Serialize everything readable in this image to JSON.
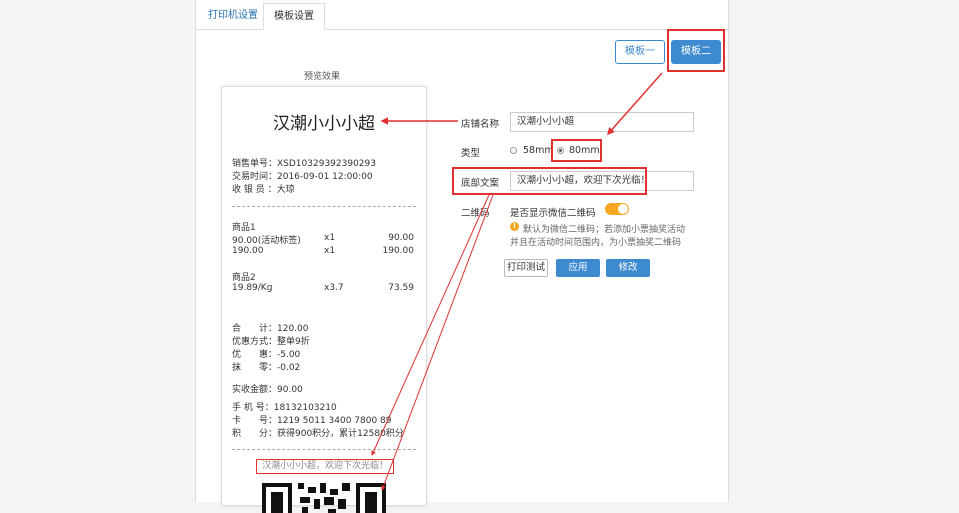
{
  "tabs": [
    {
      "label": "打印机设置"
    },
    {
      "label": "模板设置"
    }
  ],
  "template_buttons": {
    "t1": "模板一",
    "t2": "模板二"
  },
  "preview": {
    "title": "预览效果",
    "shop_name": "汉潮小小小超",
    "order_no": "销售单号：XSD10329392390293",
    "trade_time": "交易时间：2016-09-01 12:00:00",
    "cashier": "收 银 员 ：大琼",
    "items": [
      {
        "name": "商品1",
        "lines": [
          {
            "a": "90.00(活动标签)",
            "b": "x1",
            "c": "90.00"
          },
          {
            "a": "190.00",
            "b": "x1",
            "c": "190.00"
          }
        ]
      },
      {
        "name": "商品2",
        "lines": [
          {
            "a": "19.89/Kg",
            "b": "x3.7",
            "c": "73.59"
          }
        ]
      }
    ],
    "total": "合　　计：120.00",
    "discount_method": "优惠方式：整单9折",
    "discount": "优　　惠：-5.00",
    "round_off": "抹　　零：-0.02",
    "received": "实收金额：90.00",
    "phone": "手 机 号：18132103210",
    "card": "卡　　号：1219 5011 3400 7800 89",
    "points": "积　　分：获得900积分，累计12580积分",
    "footer": "汉潮小小小超，欢迎下次光临！"
  },
  "form": {
    "shop_label": "店铺名称",
    "shop_value": "汉潮小小小超",
    "type_label": "类型",
    "type_58": "58mm",
    "type_80": "80mm",
    "footer_label": "底部文案",
    "footer_value": "汉潮小小小超，欢迎下次光临！",
    "qr_label": "二维码",
    "qr_toggle_label": "是否显示微信二维码",
    "qr_note_1": "默认为微信二维码；若添加小票抽奖活动",
    "qr_note_2": "并且在活动时间范围内，为小票抽奖二维码"
  },
  "actions": {
    "test": "打印测试",
    "apply": "应用",
    "edit": "修改"
  },
  "colors": {
    "accent": "#3e8ad0",
    "highlight": "#e03030",
    "toggle": "#f5a623"
  }
}
